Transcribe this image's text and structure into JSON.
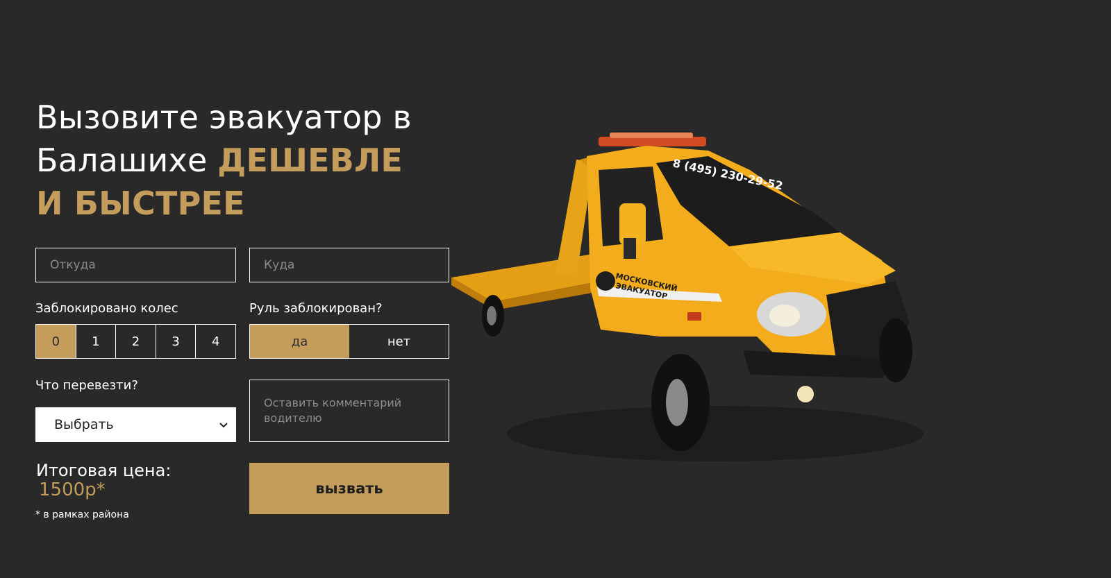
{
  "headline": {
    "line1": "Вызовите эвакуатор в",
    "line2_plain": "Балашихе ",
    "line2_accent": "ДЕШЕВЛЕ",
    "line3_accent": "И БЫСТРЕЕ"
  },
  "form": {
    "from_placeholder": "Откуда",
    "to_placeholder": "Куда",
    "wheels_label": "Заблокировано колес",
    "wheels_options": [
      "0",
      "1",
      "2",
      "3",
      "4"
    ],
    "wheels_selected": "0",
    "steering_label": "Руль заблокирован?",
    "steering_yes": "да",
    "steering_no": "нет",
    "cargo_label": "Что перевезти?",
    "cargo_select_value": "Выбрать",
    "comment_placeholder": "Оставить комментарий водителю",
    "price_label": "Итоговая цена:",
    "price_value": "1500р*",
    "price_note": "* в рамках района",
    "submit_label": "вызвать"
  },
  "truck": {
    "phone": "8 (495) 230-29-52",
    "brand_line1": "МОСКОВСКИЙ",
    "brand_line2": "ЭВАКУАТОР"
  },
  "colors": {
    "background": "#292929",
    "accent": "#c49d5c",
    "truck_body": "#f2ac1c"
  }
}
